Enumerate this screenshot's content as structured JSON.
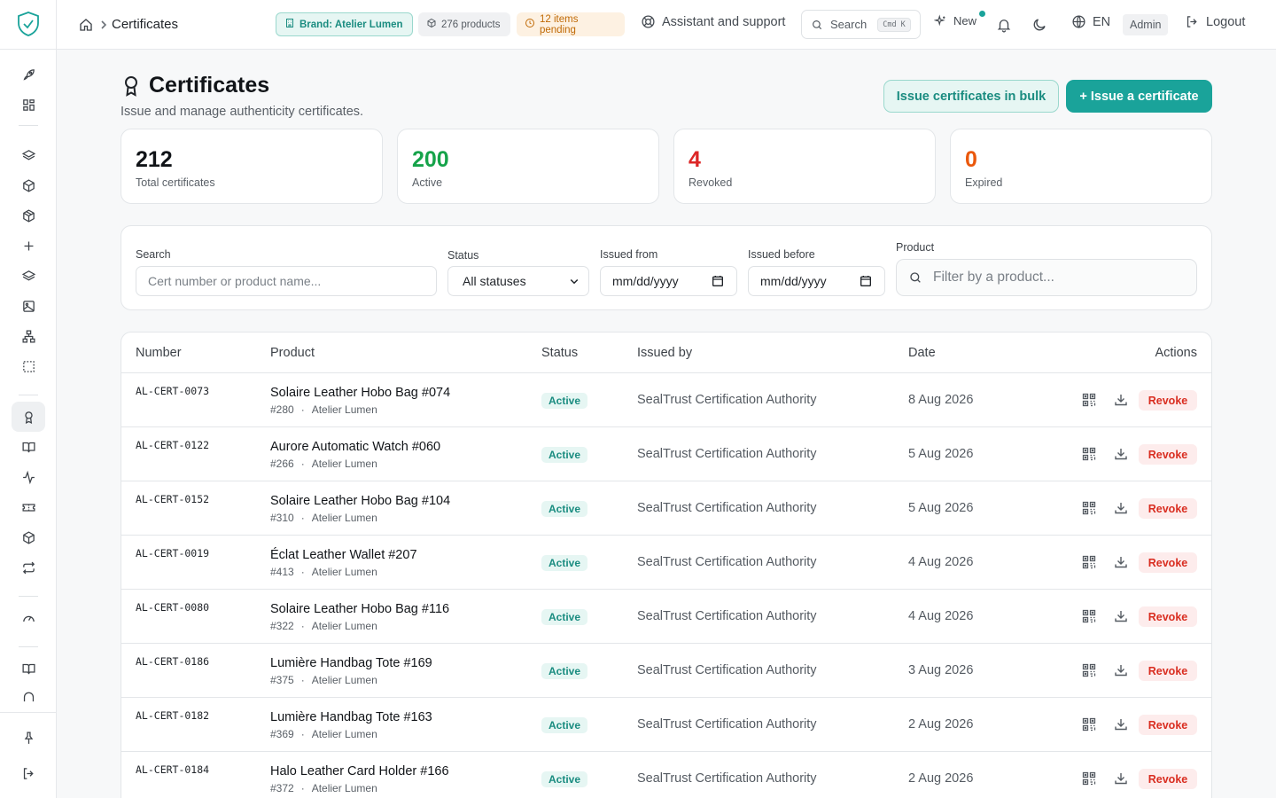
{
  "header": {
    "breadcrumb": "Certificates",
    "brand_pill": "Brand: Atelier Lumen",
    "products_pill": "276 products",
    "pending_pill": "12 items pending",
    "assistant": "Assistant and support",
    "search_label": "Search",
    "search_shortcut": "Cmd K",
    "new_label": "New",
    "language": "EN",
    "role": "Admin",
    "logout": "Logout"
  },
  "page": {
    "title": "Certificates",
    "subtitle": "Issue and manage authenticity certificates.",
    "bulk_button": "Issue certificates in bulk",
    "issue_button": "+ Issue a certificate"
  },
  "stats": [
    {
      "value": "212",
      "label": "Total certificates",
      "color": "#111418"
    },
    {
      "value": "200",
      "label": "Active",
      "color": "#16a34a"
    },
    {
      "value": "4",
      "label": "Revoked",
      "color": "#dc2626"
    },
    {
      "value": "0",
      "label": "Expired",
      "color": "#ea580c"
    }
  ],
  "filters": {
    "search_label": "Search",
    "search_placeholder": "Cert number or product name...",
    "status_label": "Status",
    "status_value": "All statuses",
    "issued_from_label": "Issued from",
    "issued_from_value": "mm/dd/yyyy",
    "issued_before_label": "Issued before",
    "issued_before_value": "mm/dd/yyyy",
    "product_label": "Product",
    "product_placeholder": "Filter by a product..."
  },
  "table": {
    "columns": {
      "number": "Number",
      "product": "Product",
      "status": "Status",
      "issued_by": "Issued by",
      "date": "Date",
      "actions": "Actions"
    },
    "revoke_label": "Revoke",
    "rows": [
      {
        "number": "AL-CERT-0073",
        "product": "Solaire Leather Hobo Bag #074",
        "id": "#280",
        "brand": "Atelier Lumen",
        "status": "Active",
        "issuer": "SealTrust Certification Authority",
        "date": "8 Aug 2026"
      },
      {
        "number": "AL-CERT-0122",
        "product": "Aurore Automatic Watch #060",
        "id": "#266",
        "brand": "Atelier Lumen",
        "status": "Active",
        "issuer": "SealTrust Certification Authority",
        "date": "5 Aug 2026"
      },
      {
        "number": "AL-CERT-0152",
        "product": "Solaire Leather Hobo Bag #104",
        "id": "#310",
        "brand": "Atelier Lumen",
        "status": "Active",
        "issuer": "SealTrust Certification Authority",
        "date": "5 Aug 2026"
      },
      {
        "number": "AL-CERT-0019",
        "product": "Éclat Leather Wallet #207",
        "id": "#413",
        "brand": "Atelier Lumen",
        "status": "Active",
        "issuer": "SealTrust Certification Authority",
        "date": "4 Aug 2026"
      },
      {
        "number": "AL-CERT-0080",
        "product": "Solaire Leather Hobo Bag #116",
        "id": "#322",
        "brand": "Atelier Lumen",
        "status": "Active",
        "issuer": "SealTrust Certification Authority",
        "date": "4 Aug 2026"
      },
      {
        "number": "AL-CERT-0186",
        "product": "Lumière Handbag Tote #169",
        "id": "#375",
        "brand": "Atelier Lumen",
        "status": "Active",
        "issuer": "SealTrust Certification Authority",
        "date": "3 Aug 2026"
      },
      {
        "number": "AL-CERT-0182",
        "product": "Lumière Handbag Tote #163",
        "id": "#369",
        "brand": "Atelier Lumen",
        "status": "Active",
        "issuer": "SealTrust Certification Authority",
        "date": "2 Aug 2026"
      },
      {
        "number": "AL-CERT-0184",
        "product": "Halo Leather Card Holder #166",
        "id": "#372",
        "brand": "Atelier Lumen",
        "status": "Active",
        "issuer": "SealTrust Certification Authority",
        "date": "2 Aug 2026"
      }
    ]
  }
}
